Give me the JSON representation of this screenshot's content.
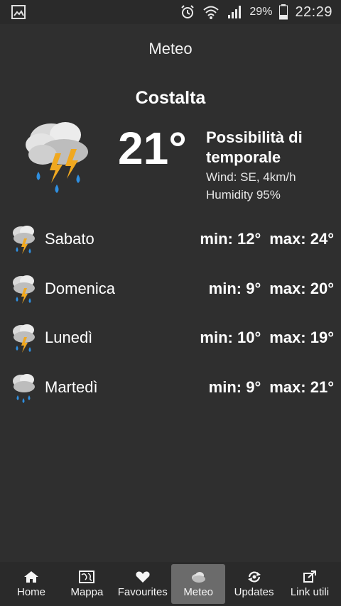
{
  "status_bar": {
    "battery": "29%",
    "time": "22:29",
    "icons": [
      "image-icon",
      "alarm-icon",
      "wifi-icon",
      "signal-icon",
      "battery-icon"
    ]
  },
  "app": {
    "title": "Meteo"
  },
  "location": "Costalta",
  "current": {
    "temperature": "21°",
    "description": "Possibilità di temporale",
    "wind": "Wind: SE, 4km/h",
    "humidity": "Humidity 95%",
    "icon": "thunderstorm-icon"
  },
  "forecast": [
    {
      "day": "Sabato",
      "min": "min: 12°",
      "max": "max: 24°",
      "icon": "thunderstorm-icon"
    },
    {
      "day": "Domenica",
      "min": "min: 9°",
      "max": "max: 20°",
      "icon": "thunderstorm-icon"
    },
    {
      "day": "Lunedì",
      "min": "min: 10°",
      "max": "max: 19°",
      "icon": "thunderstorm-icon"
    },
    {
      "day": "Martedì",
      "min": "min: 9°",
      "max": "max: 21°",
      "icon": "rain-icon"
    }
  ],
  "nav": [
    {
      "label": "Home",
      "icon": "home-icon"
    },
    {
      "label": "Mappa",
      "icon": "map-icon"
    },
    {
      "label": "Favourites",
      "icon": "heart-icon"
    },
    {
      "label": "Meteo",
      "icon": "cloud-icon",
      "active": true
    },
    {
      "label": "Updates",
      "icon": "refresh-icon"
    },
    {
      "label": "Link utili",
      "icon": "external-link-icon"
    }
  ],
  "colors": {
    "background": "#2f2f2f",
    "text": "#ffffff",
    "active_tab": "#6b6b6b"
  }
}
